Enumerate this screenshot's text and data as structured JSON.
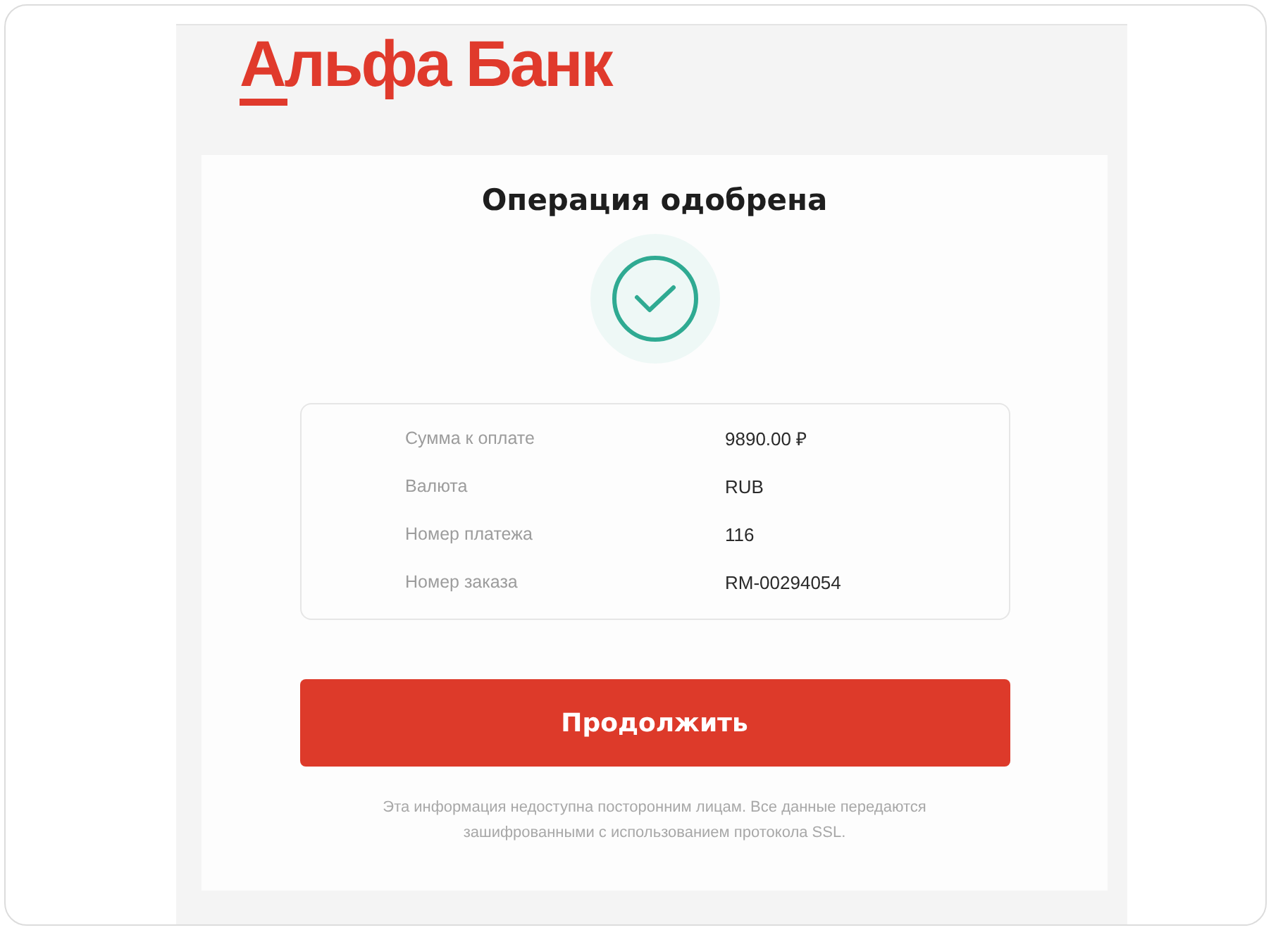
{
  "logo": {
    "text": "Альфа Банк"
  },
  "card": {
    "title": "Операция одобрена"
  },
  "details": [
    {
      "label": "Сумма к оплате",
      "value": "9890.00 ₽"
    },
    {
      "label": "Валюта",
      "value": "RUB"
    },
    {
      "label": "Номер платежа",
      "value": "116"
    },
    {
      "label": "Номер заказа",
      "value": "RM-00294054"
    }
  ],
  "button": {
    "label": "Продолжить"
  },
  "footer_note": "Эта информация недоступна посторонним лицам. Все данные передаются зашифрованными с использованием протокола SSL."
}
